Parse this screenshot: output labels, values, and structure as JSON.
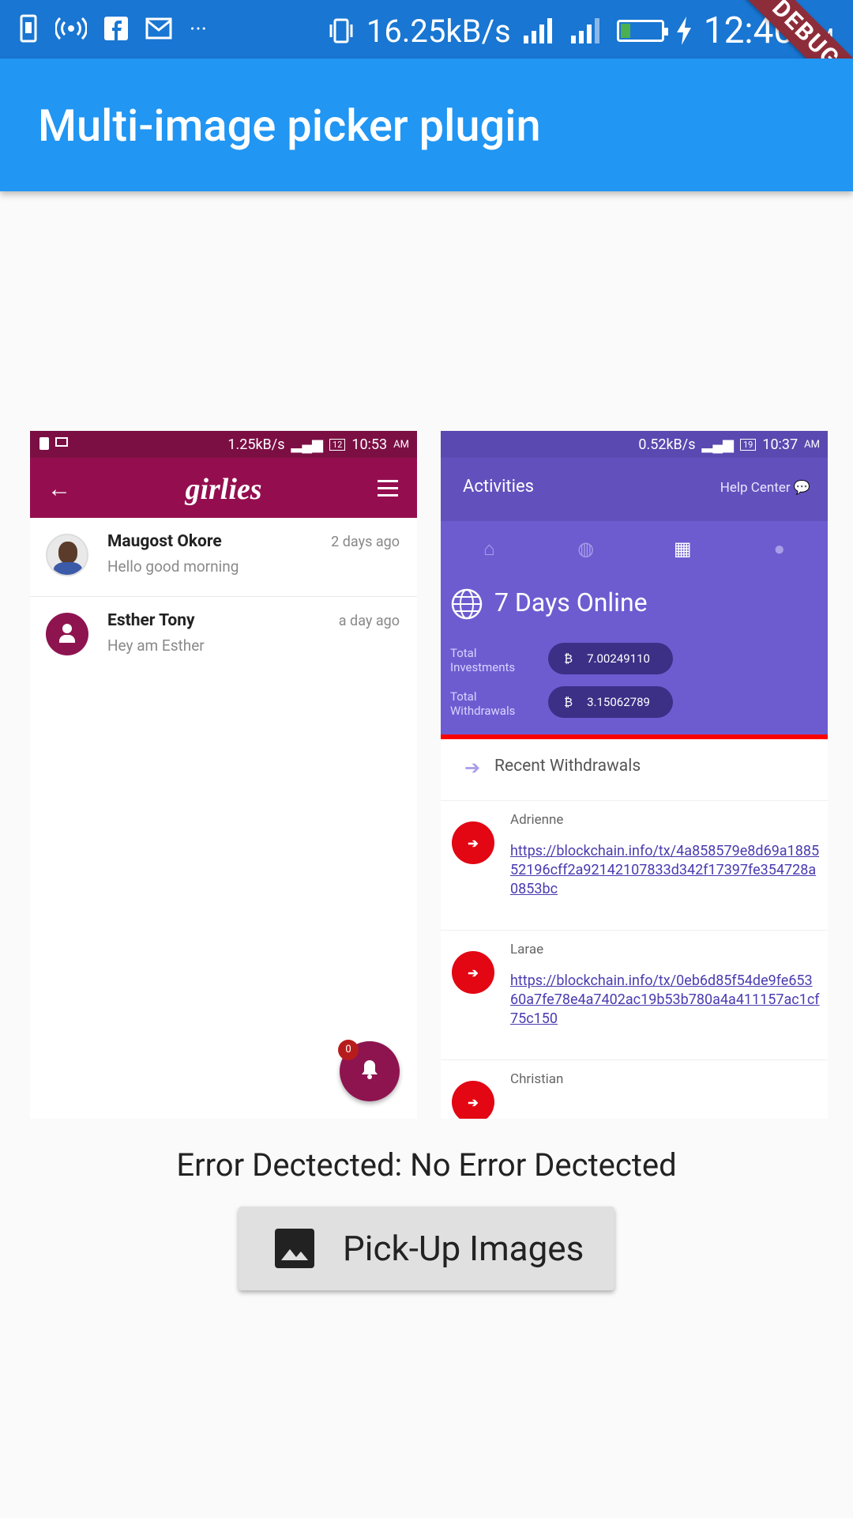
{
  "status_bar": {
    "speed": "16.25kB/s",
    "time": "12:40",
    "ampm": "AM",
    "debug_label": "DEBUG"
  },
  "appbar": {
    "title": "Multi-image picker plugin"
  },
  "left_image": {
    "status": {
      "speed": "1.25kB/s",
      "time": "10:53",
      "ampm": "AM",
      "battery": "12"
    },
    "logo": "girlies",
    "chats": [
      {
        "name": "Maugost Okore",
        "message": "Hello good morning",
        "time": "2 days ago"
      },
      {
        "name": "Esther Tony",
        "message": "Hey am Esther",
        "time": "a day ago"
      }
    ],
    "badge_count": "0"
  },
  "right_image": {
    "status": {
      "speed": "0.52kB/s",
      "time": "10:37",
      "ampm": "AM",
      "battery": "19"
    },
    "title": "Activities",
    "help": "Help Center",
    "online": "7 Days Online",
    "total_investments_label": "Total Investments",
    "total_investments_value": "7.00249110",
    "total_withdrawals_label": "Total Withdrawals",
    "total_withdrawals_value": "3.15062789",
    "section_title": "Recent Withdrawals",
    "withdrawals": [
      {
        "name": "Adrienne",
        "link": "https://blockchain.info/tx/4a858579e8d69a188552196cff2a92142107833d342f17397fe354728a0853bc"
      },
      {
        "name": "Larae",
        "link": "https://blockchain.info/tx/0eb6d85f54de9fe65360a7fe78e4a7402ac19b53b780a4a411157ac1cf75c150"
      },
      {
        "name": "Christian",
        "link": ""
      }
    ]
  },
  "error_text": "Error Dectected: No Error Dectected",
  "pick_button": {
    "label": "Pick-Up Images"
  },
  "colors": {
    "appbar": "#2196f3",
    "statusbar": "#1976d2",
    "girlies": "#940e4f",
    "purple": "#6d5cd0"
  }
}
